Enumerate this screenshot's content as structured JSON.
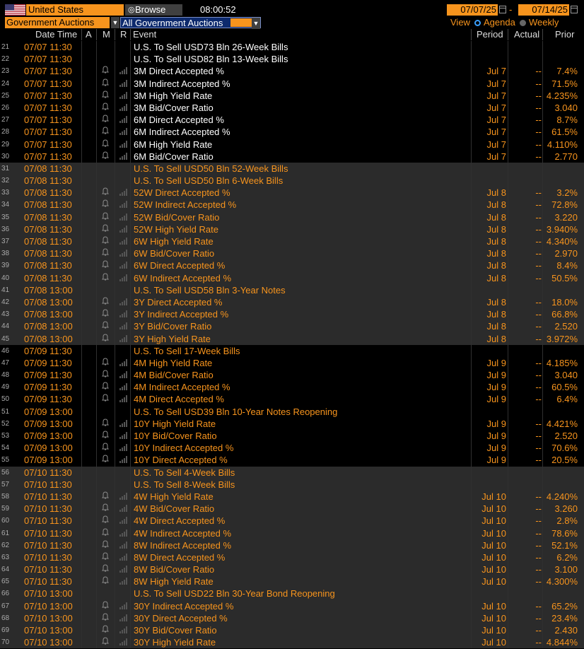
{
  "toolbar": {
    "country": "United States",
    "browse_label": "Browse",
    "time": "08:00:52",
    "date_from": "07/07/25",
    "date_separator": "-",
    "date_to": "07/14/25"
  },
  "filters": {
    "category": "Government Auctions",
    "subcategory": "All Government Auctions",
    "view_label": "View",
    "agenda_label": "Agenda",
    "weekly_label": "Weekly"
  },
  "columns": {
    "datetime": "Date Time",
    "a": "A",
    "m": "M",
    "r": "R",
    "event": "Event",
    "period": "Period",
    "actual": "Actual",
    "prior": "Prior"
  },
  "colors": {
    "accent": "#f7941d",
    "text_white": "#ffffff",
    "row_shade": "#2b2b2b",
    "selected_bg": "#0d2a6d"
  },
  "rows": [
    {
      "n": "21",
      "dt": "07/07 11:30",
      "ev": "U.S. To Sell USD73 Bln 26-Week Bills",
      "per": "",
      "act": "",
      "pri": "",
      "icons": false,
      "shade": false,
      "orange": false
    },
    {
      "n": "22",
      "dt": "07/07 11:30",
      "ev": "U.S. To Sell USD82 Bln 13-Week Bills",
      "per": "",
      "act": "",
      "pri": "",
      "icons": false,
      "shade": false,
      "orange": false
    },
    {
      "n": "23",
      "dt": "07/07 11:30",
      "ev": "3M Direct Accepted %",
      "per": "Jul 7",
      "act": "--",
      "pri": "7.4%",
      "icons": true,
      "shade": false,
      "orange": false
    },
    {
      "n": "24",
      "dt": "07/07 11:30",
      "ev": "3M Indirect Accepted %",
      "per": "Jul 7",
      "act": "--",
      "pri": "71.5%",
      "icons": true,
      "shade": false,
      "orange": false
    },
    {
      "n": "25",
      "dt": "07/07 11:30",
      "ev": "3M High Yield Rate",
      "per": "Jul 7",
      "act": "--",
      "pri": "4.235%",
      "icons": true,
      "shade": false,
      "orange": false
    },
    {
      "n": "26",
      "dt": "07/07 11:30",
      "ev": "3M Bid/Cover Ratio",
      "per": "Jul 7",
      "act": "--",
      "pri": "3.040",
      "icons": true,
      "shade": false,
      "orange": false
    },
    {
      "n": "27",
      "dt": "07/07 11:30",
      "ev": "6M Direct Accepted %",
      "per": "Jul 7",
      "act": "--",
      "pri": "8.7%",
      "icons": true,
      "shade": false,
      "orange": false
    },
    {
      "n": "28",
      "dt": "07/07 11:30",
      "ev": "6M Indirect Accepted %",
      "per": "Jul 7",
      "act": "--",
      "pri": "61.5%",
      "icons": true,
      "shade": false,
      "orange": false
    },
    {
      "n": "29",
      "dt": "07/07 11:30",
      "ev": "6M High Yield Rate",
      "per": "Jul 7",
      "act": "--",
      "pri": "4.110%",
      "icons": true,
      "shade": false,
      "orange": false
    },
    {
      "n": "30",
      "dt": "07/07 11:30",
      "ev": "6M Bid/Cover Ratio",
      "per": "Jul 7",
      "act": "--",
      "pri": "2.770",
      "icons": true,
      "shade": false,
      "orange": false
    },
    {
      "n": "31",
      "dt": "07/08 11:30",
      "ev": "U.S. To Sell USD50 Bln 52-Week Bills",
      "per": "",
      "act": "",
      "pri": "",
      "icons": false,
      "shade": true,
      "orange": true
    },
    {
      "n": "32",
      "dt": "07/08 11:30",
      "ev": "U.S. To Sell USD50 Bln 6-Week Bills",
      "per": "",
      "act": "",
      "pri": "",
      "icons": false,
      "shade": true,
      "orange": true
    },
    {
      "n": "33",
      "dt": "07/08 11:30",
      "ev": "52W Direct Accepted %",
      "per": "Jul 8",
      "act": "--",
      "pri": "3.2%",
      "icons": true,
      "shade": true,
      "orange": true
    },
    {
      "n": "34",
      "dt": "07/08 11:30",
      "ev": "52W Indirect Accepted %",
      "per": "Jul 8",
      "act": "--",
      "pri": "72.8%",
      "icons": true,
      "shade": true,
      "orange": true
    },
    {
      "n": "35",
      "dt": "07/08 11:30",
      "ev": "52W Bid/Cover Ratio",
      "per": "Jul 8",
      "act": "--",
      "pri": "3.220",
      "icons": true,
      "shade": true,
      "orange": true
    },
    {
      "n": "36",
      "dt": "07/08 11:30",
      "ev": "52W High Yield Rate",
      "per": "Jul 8",
      "act": "--",
      "pri": "3.940%",
      "icons": true,
      "shade": true,
      "orange": true
    },
    {
      "n": "37",
      "dt": "07/08 11:30",
      "ev": "6W High Yield Rate",
      "per": "Jul 8",
      "act": "--",
      "pri": "4.340%",
      "icons": true,
      "shade": true,
      "orange": true
    },
    {
      "n": "38",
      "dt": "07/08 11:30",
      "ev": "6W Bid/Cover Ratio",
      "per": "Jul 8",
      "act": "--",
      "pri": "2.970",
      "icons": true,
      "shade": true,
      "orange": true
    },
    {
      "n": "39",
      "dt": "07/08 11:30",
      "ev": "6W Direct Accepted %",
      "per": "Jul 8",
      "act": "--",
      "pri": "8.4%",
      "icons": true,
      "shade": true,
      "orange": true
    },
    {
      "n": "40",
      "dt": "07/08 11:30",
      "ev": "6W Indirect Accepted %",
      "per": "Jul 8",
      "act": "--",
      "pri": "50.5%",
      "icons": true,
      "shade": true,
      "orange": true
    },
    {
      "n": "41",
      "dt": "07/08 13:00",
      "ev": "U.S. To Sell USD58 Bln 3-Year Notes",
      "per": "",
      "act": "",
      "pri": "",
      "icons": false,
      "shade": true,
      "orange": true
    },
    {
      "n": "42",
      "dt": "07/08 13:00",
      "ev": "3Y Direct Accepted %",
      "per": "Jul 8",
      "act": "--",
      "pri": "18.0%",
      "icons": true,
      "shade": true,
      "orange": true
    },
    {
      "n": "43",
      "dt": "07/08 13:00",
      "ev": "3Y Indirect Accepted %",
      "per": "Jul 8",
      "act": "--",
      "pri": "66.8%",
      "icons": true,
      "shade": true,
      "orange": true
    },
    {
      "n": "44",
      "dt": "07/08 13:00",
      "ev": "3Y Bid/Cover Ratio",
      "per": "Jul 8",
      "act": "--",
      "pri": "2.520",
      "icons": true,
      "shade": true,
      "orange": true
    },
    {
      "n": "45",
      "dt": "07/08 13:00",
      "ev": "3Y High Yield Rate",
      "per": "Jul 8",
      "act": "--",
      "pri": "3.972%",
      "icons": true,
      "shade": true,
      "orange": true
    },
    {
      "n": "46",
      "dt": "07/09 11:30",
      "ev": "U.S. To Sell 17-Week Bills",
      "per": "",
      "act": "",
      "pri": "",
      "icons": false,
      "shade": false,
      "orange": true
    },
    {
      "n": "47",
      "dt": "07/09 11:30",
      "ev": "4M High Yield Rate",
      "per": "Jul 9",
      "act": "--",
      "pri": "4.185%",
      "icons": true,
      "shade": false,
      "orange": true
    },
    {
      "n": "48",
      "dt": "07/09 11:30",
      "ev": "4M Bid/Cover Ratio",
      "per": "Jul 9",
      "act": "--",
      "pri": "3.040",
      "icons": true,
      "shade": false,
      "orange": true
    },
    {
      "n": "49",
      "dt": "07/09 11:30",
      "ev": "4M Indirect Accepted %",
      "per": "Jul 9",
      "act": "--",
      "pri": "60.5%",
      "icons": true,
      "shade": false,
      "orange": true
    },
    {
      "n": "50",
      "dt": "07/09 11:30",
      "ev": "4M Direct Accepted %",
      "per": "Jul 9",
      "act": "--",
      "pri": "6.4%",
      "icons": true,
      "shade": false,
      "orange": true
    },
    {
      "n": "51",
      "dt": "07/09 13:00",
      "ev": "U.S. To Sell USD39 Bln 10-Year Notes Reopening",
      "per": "",
      "act": "",
      "pri": "",
      "icons": false,
      "shade": false,
      "orange": true
    },
    {
      "n": "52",
      "dt": "07/09 13:00",
      "ev": "10Y High Yield Rate",
      "per": "Jul 9",
      "act": "--",
      "pri": "4.421%",
      "icons": true,
      "shade": false,
      "orange": true
    },
    {
      "n": "53",
      "dt": "07/09 13:00",
      "ev": "10Y Bid/Cover Ratio",
      "per": "Jul 9",
      "act": "--",
      "pri": "2.520",
      "icons": true,
      "shade": false,
      "orange": true
    },
    {
      "n": "54",
      "dt": "07/09 13:00",
      "ev": "10Y Indirect Accepted %",
      "per": "Jul 9",
      "act": "--",
      "pri": "70.6%",
      "icons": true,
      "shade": false,
      "orange": true
    },
    {
      "n": "55",
      "dt": "07/09 13:00",
      "ev": "10Y Direct Accepted %",
      "per": "Jul 9",
      "act": "--",
      "pri": "20.5%",
      "icons": true,
      "shade": false,
      "orange": true
    },
    {
      "n": "56",
      "dt": "07/10 11:30",
      "ev": "U.S. To Sell 4-Week Bills",
      "per": "",
      "act": "",
      "pri": "",
      "icons": false,
      "shade": true,
      "orange": true
    },
    {
      "n": "57",
      "dt": "07/10 11:30",
      "ev": "U.S. To Sell 8-Week Bills",
      "per": "",
      "act": "",
      "pri": "",
      "icons": false,
      "shade": true,
      "orange": true
    },
    {
      "n": "58",
      "dt": "07/10 11:30",
      "ev": "4W High Yield Rate",
      "per": "Jul 10",
      "act": "--",
      "pri": "4.240%",
      "icons": true,
      "shade": true,
      "orange": true
    },
    {
      "n": "59",
      "dt": "07/10 11:30",
      "ev": "4W Bid/Cover Ratio",
      "per": "Jul 10",
      "act": "--",
      "pri": "3.260",
      "icons": true,
      "shade": true,
      "orange": true
    },
    {
      "n": "60",
      "dt": "07/10 11:30",
      "ev": "4W Direct Accepted %",
      "per": "Jul 10",
      "act": "--",
      "pri": "2.8%",
      "icons": true,
      "shade": true,
      "orange": true
    },
    {
      "n": "61",
      "dt": "07/10 11:30",
      "ev": "4W Indirect Accepted %",
      "per": "Jul 10",
      "act": "--",
      "pri": "78.6%",
      "icons": true,
      "shade": true,
      "orange": true
    },
    {
      "n": "62",
      "dt": "07/10 11:30",
      "ev": "8W Indirect Accepted %",
      "per": "Jul 10",
      "act": "--",
      "pri": "52.1%",
      "icons": true,
      "shade": true,
      "orange": true
    },
    {
      "n": "63",
      "dt": "07/10 11:30",
      "ev": "8W Direct Accepted %",
      "per": "Jul 10",
      "act": "--",
      "pri": "6.2%",
      "icons": true,
      "shade": true,
      "orange": true
    },
    {
      "n": "64",
      "dt": "07/10 11:30",
      "ev": "8W Bid/Cover Ratio",
      "per": "Jul 10",
      "act": "--",
      "pri": "3.100",
      "icons": true,
      "shade": true,
      "orange": true
    },
    {
      "n": "65",
      "dt": "07/10 11:30",
      "ev": "8W High Yield Rate",
      "per": "Jul 10",
      "act": "--",
      "pri": "4.300%",
      "icons": true,
      "shade": true,
      "orange": true
    },
    {
      "n": "66",
      "dt": "07/10 13:00",
      "ev": "U.S. To Sell USD22 Bln 30-Year Bond Reopening",
      "per": "",
      "act": "",
      "pri": "",
      "icons": false,
      "shade": true,
      "orange": true
    },
    {
      "n": "67",
      "dt": "07/10 13:00",
      "ev": "30Y Indirect Accepted %",
      "per": "Jul 10",
      "act": "--",
      "pri": "65.2%",
      "icons": true,
      "shade": true,
      "orange": true
    },
    {
      "n": "68",
      "dt": "07/10 13:00",
      "ev": "30Y Direct Accepted %",
      "per": "Jul 10",
      "act": "--",
      "pri": "23.4%",
      "icons": true,
      "shade": true,
      "orange": true
    },
    {
      "n": "69",
      "dt": "07/10 13:00",
      "ev": "30Y Bid/Cover Ratio",
      "per": "Jul 10",
      "act": "--",
      "pri": "2.430",
      "icons": true,
      "shade": true,
      "orange": true
    },
    {
      "n": "70",
      "dt": "07/10 13:00",
      "ev": "30Y High Yield Rate",
      "per": "Jul 10",
      "act": "--",
      "pri": "4.844%",
      "icons": true,
      "shade": true,
      "orange": true
    }
  ]
}
